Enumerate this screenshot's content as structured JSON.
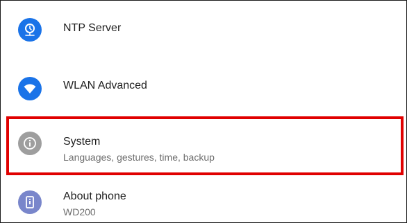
{
  "settings": {
    "items": [
      {
        "title": "NTP Server",
        "subtitle": "",
        "icon": "clock-icon",
        "icon_color": "#1a73e8"
      },
      {
        "title": "WLAN Advanced",
        "subtitle": "",
        "icon": "wifi-icon",
        "icon_color": "#1a73e8"
      },
      {
        "title": "System",
        "subtitle": "Languages, gestures, time, backup",
        "icon": "info-icon",
        "icon_color": "#9e9e9e"
      },
      {
        "title": "About phone",
        "subtitle": "WD200",
        "icon": "phone-icon",
        "icon_color": "#7986cb"
      }
    ]
  },
  "colors": {
    "highlight_border": "#e00000"
  }
}
